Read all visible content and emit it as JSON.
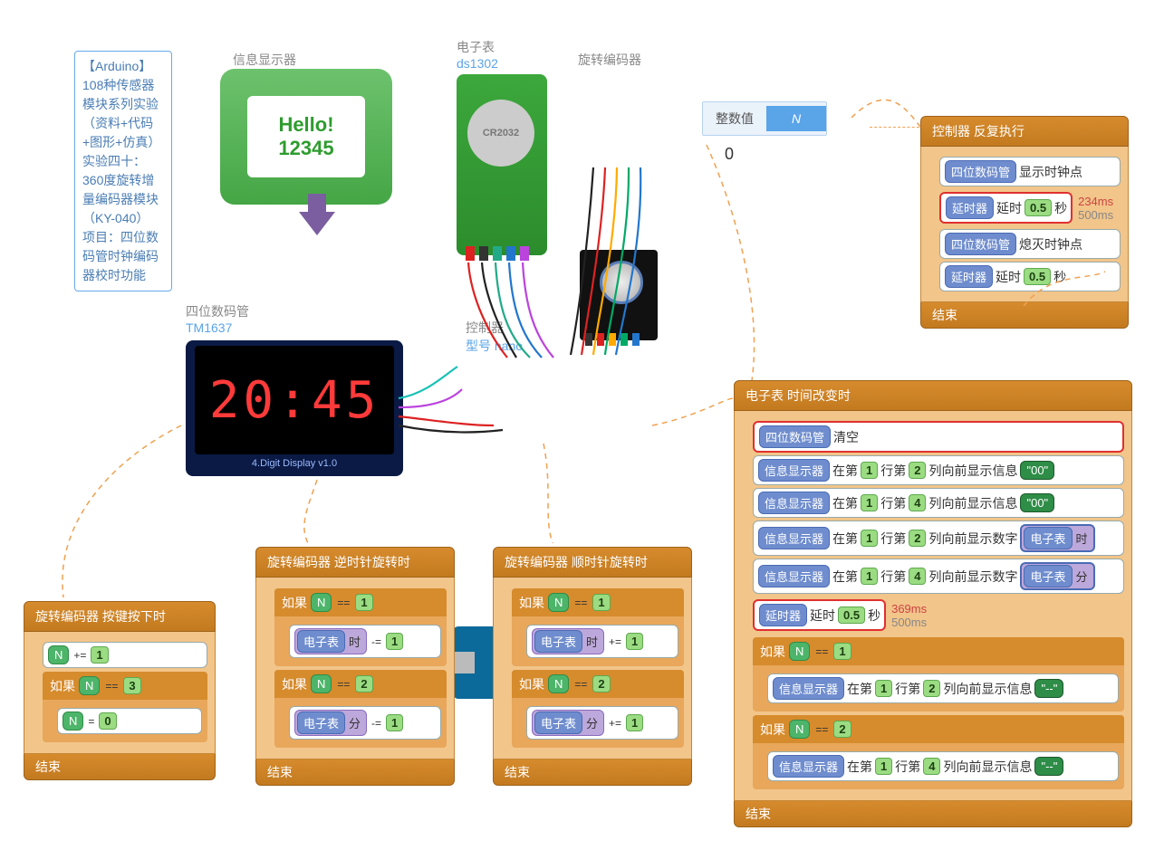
{
  "description": "【Arduino】108种传感器模块系列实验（资料+代码+图形+仿真）\n实验四十：360度旋转增量编码器模块（KY-040）\n项目：四位数码管时钟编码器校时功能",
  "components": {
    "info_display": {
      "label": "信息显示器",
      "line1": "Hello!",
      "line2": "12345"
    },
    "ds1302": {
      "label": "电子表",
      "sublabel": "ds1302",
      "battery": "CR2032"
    },
    "rotary": {
      "label": "旋转编码器"
    },
    "segment": {
      "label": "四位数码管",
      "sublabel": "TM1637",
      "value": "20:45",
      "board_text": "4.Digit Display   v1.0"
    },
    "controller": {
      "label": "控制器",
      "sublabel": "型号 nano"
    },
    "timer_icon": {
      "label": "延时器"
    }
  },
  "intvar": {
    "label": "整数值",
    "var": "N",
    "value": "0"
  },
  "tokens": {
    "if": "如果",
    "end": "结束",
    "var_N": "N",
    "eq": "==",
    "pluseq": "+=",
    "minuseq": "-=",
    "assign": "=",
    "segment": "四位数码管",
    "timer": "延时器",
    "delay": "延时",
    "sec": "秒",
    "val05": "0.5",
    "clock": "电子表",
    "hour": "时",
    "minute": "分",
    "info": "信息显示器",
    "at_row": "在第",
    "row_col": "行第",
    "col_front_msg": "列向前显示信息",
    "col_front_num": "列向前显示数字",
    "clear": "清空",
    "show_clock": "显示时钟点",
    "hide_clock": "熄灭时钟点",
    "str00": "\"00\"",
    "strdd": "\"--\"",
    "controller_loop_hdr": "控制器 反复执行",
    "clock_change_hdr": "电子表 时间改变时",
    "rotary_press_hdr": "旋转编码器 按键按下时",
    "rotary_ccw_hdr": "旋转编码器 逆时针旋转时",
    "rotary_cw_hdr": "旋转编码器 顺时针旋转时",
    "n1": "1",
    "n2": "2",
    "n3": "3",
    "n0": "0",
    "n4": "4"
  },
  "annotations": {
    "loop_delay_ms": "234ms",
    "loop_delay_total": "500ms",
    "clock_delay_ms": "369ms",
    "clock_delay_total": "500ms"
  }
}
